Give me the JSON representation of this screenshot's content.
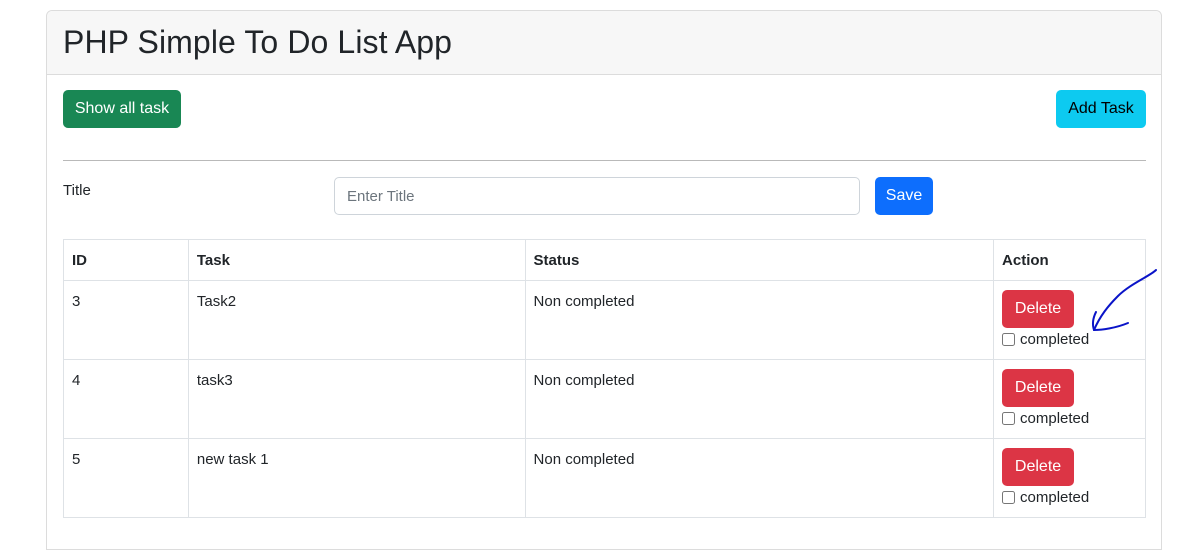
{
  "header": {
    "title": "PHP Simple To Do List App"
  },
  "toolbar": {
    "show_all_label": "Show all task",
    "add_task_label": "Add Task"
  },
  "form": {
    "title_label": "Title",
    "title_placeholder": "Enter Title",
    "title_value": "",
    "save_label": "Save"
  },
  "table": {
    "headers": [
      "ID",
      "Task",
      "Status",
      "Action"
    ],
    "rows": [
      {
        "id": "3",
        "task": "Task2",
        "status": "Non completed",
        "delete_label": "Delete",
        "completed_label": "completed",
        "checked": false
      },
      {
        "id": "4",
        "task": "task3",
        "status": "Non completed",
        "delete_label": "Delete",
        "completed_label": "completed",
        "checked": false
      },
      {
        "id": "5",
        "task": "new task 1",
        "status": "Non completed",
        "delete_label": "Delete",
        "completed_label": "completed",
        "checked": false
      }
    ]
  },
  "colors": {
    "success": "#198754",
    "info": "#0dcaf0",
    "primary": "#0d6efd",
    "danger": "#dc3545",
    "annotation": "#0a14c8"
  },
  "icons": {
    "annotation": "hand-drawn-arrow-icon"
  }
}
